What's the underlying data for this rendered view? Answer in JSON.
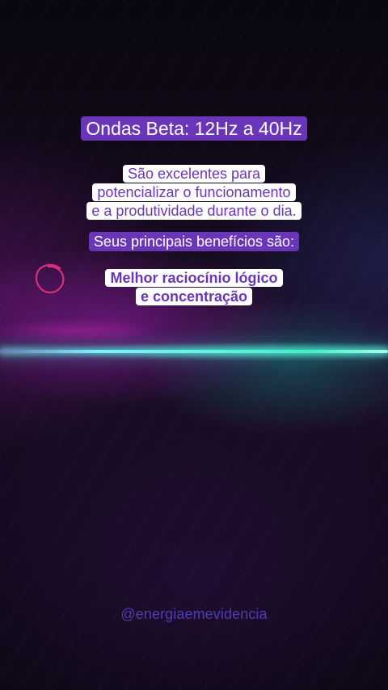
{
  "title": "Ondas Beta: 12Hz a 40Hz",
  "description": {
    "line1": "São excelentes para",
    "line2": "potencializar o funcionamento",
    "line3": "e a produtividade durante o  dia."
  },
  "benefits_intro": "Seus principais benefícios são:",
  "benefit": {
    "line1": "Melhor raciocínio lógico",
    "line2": "e concentração"
  },
  "handle": "@energiaemevidencia",
  "colors": {
    "accent_violet": "#6a35b8",
    "laser_cyan": "#5cf5e0",
    "circle_pink": "#d8307a"
  },
  "icons": {
    "circle_mark": "hand-drawn-circle"
  }
}
